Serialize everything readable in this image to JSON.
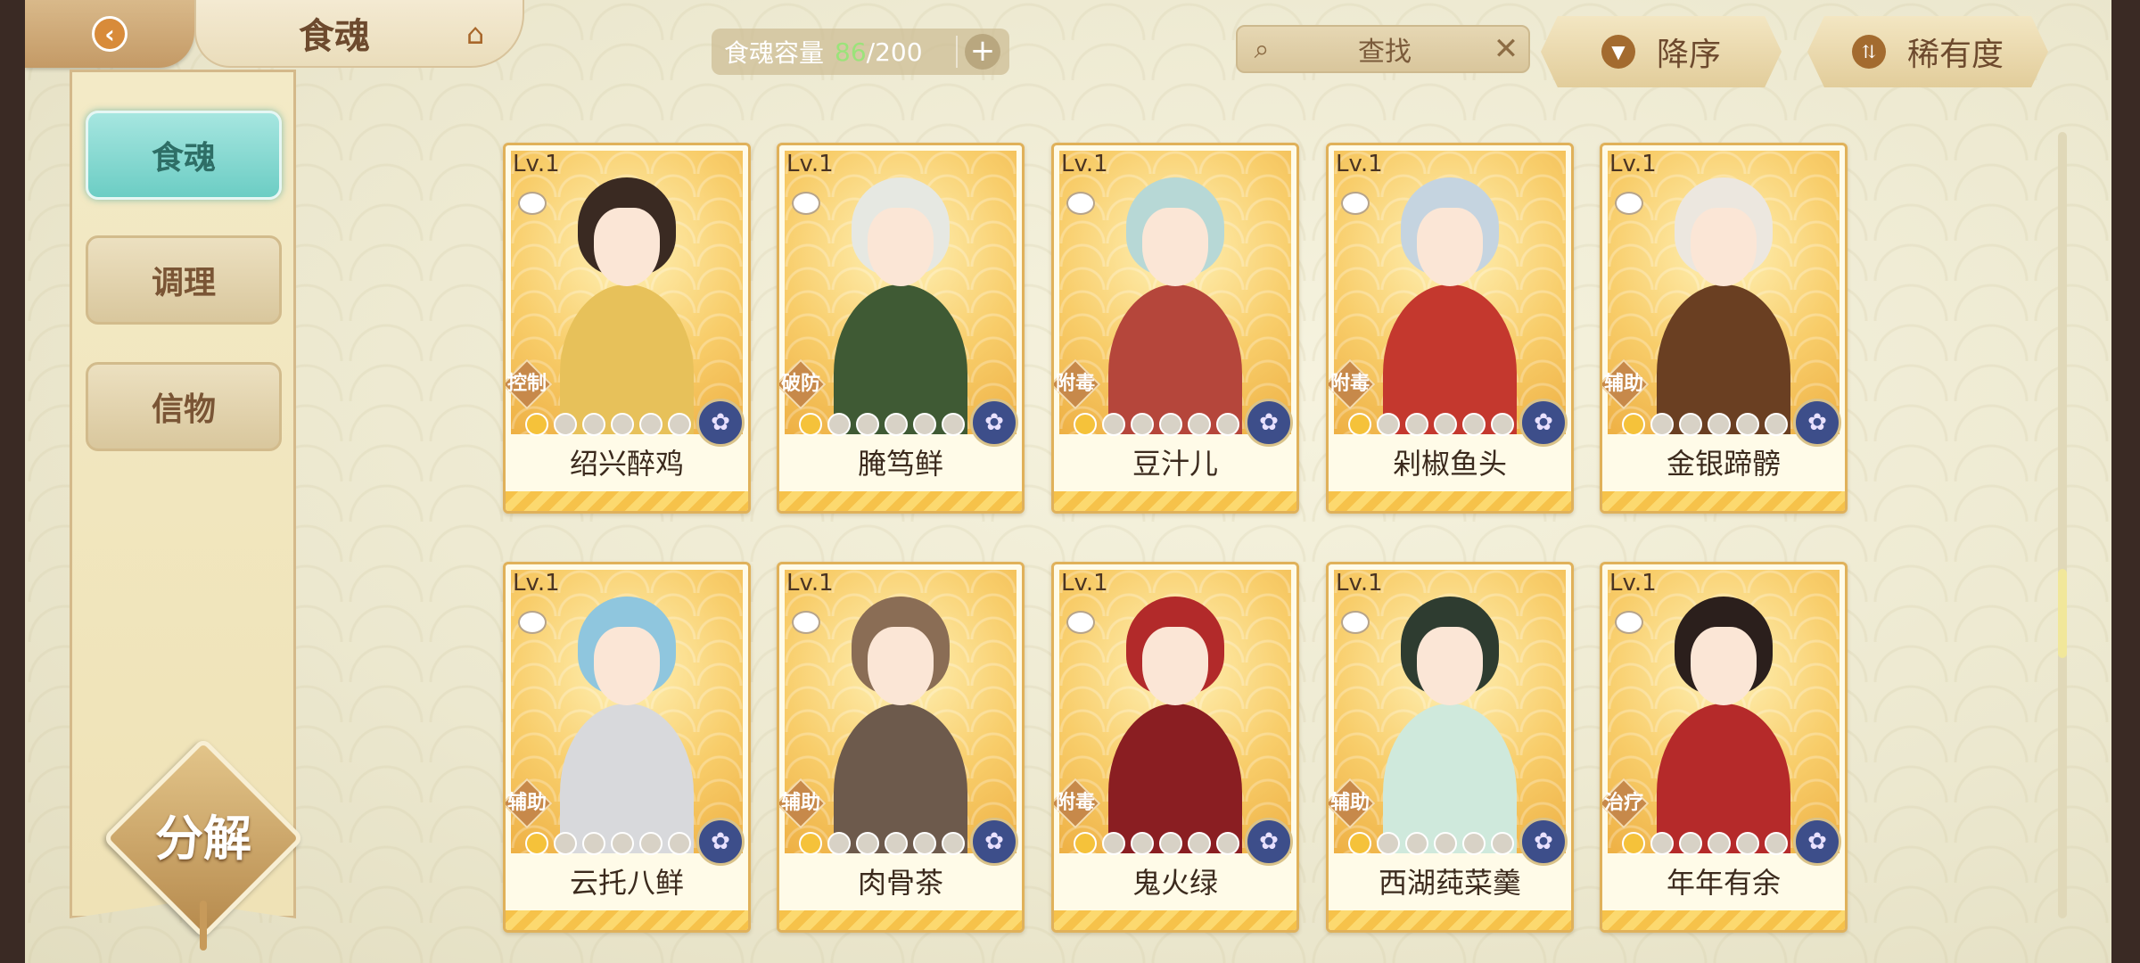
{
  "header": {
    "back_icon": "back-arrow-icon",
    "title": "食魂",
    "home_icon": "pavilion-icon",
    "capacity": {
      "label": "食魂容量",
      "current": "86",
      "max": "/200",
      "plus": "+"
    },
    "search": {
      "label": "查找",
      "icon": "search-icon",
      "clear_icon": "close-icon"
    },
    "sort_button": {
      "label": "降序",
      "icon": "triangle-down-icon"
    },
    "rarity_button": {
      "label": "稀有度",
      "icon": "sort-arrows-icon"
    }
  },
  "sidebar": {
    "items": [
      {
        "label": "食魂",
        "active": true
      },
      {
        "label": "调理",
        "active": false
      },
      {
        "label": "信物",
        "active": false
      }
    ],
    "decompose_label": "分解"
  },
  "cards": [
    {
      "level": "Lv.1",
      "name": "绍兴醉鸡",
      "role": "控制",
      "stars": 1,
      "colors": {
        "hair": "#3a2a22",
        "body": "#e7c15a"
      }
    },
    {
      "level": "Lv.1",
      "name": "腌笃鲜",
      "role": "破防",
      "stars": 1,
      "colors": {
        "hair": "#e6e8e2",
        "body": "#3f5a34"
      }
    },
    {
      "level": "Lv.1",
      "name": "豆汁儿",
      "role": "附毒",
      "stars": 1,
      "colors": {
        "hair": "#b7d8d6",
        "body": "#b5463b"
      }
    },
    {
      "level": "Lv.1",
      "name": "剁椒鱼头",
      "role": "附毒",
      "stars": 1,
      "colors": {
        "hair": "#c5d4e0",
        "body": "#c4382e"
      }
    },
    {
      "level": "Lv.1",
      "name": "金银蹄髈",
      "role": "辅助",
      "stars": 1,
      "colors": {
        "hair": "#ece7df",
        "body": "#6a3f22"
      }
    },
    {
      "level": "Lv.1",
      "name": "云托八鲜",
      "role": "辅助",
      "stars": 1,
      "colors": {
        "hair": "#8fc6de",
        "body": "#d8d9dc"
      }
    },
    {
      "level": "Lv.1",
      "name": "肉骨茶",
      "role": "辅助",
      "stars": 1,
      "colors": {
        "hair": "#8a6d55",
        "body": "#6d5a4c"
      }
    },
    {
      "level": "Lv.1",
      "name": "鬼火绿",
      "role": "附毒",
      "stars": 1,
      "colors": {
        "hair": "#b22a2a",
        "body": "#8a1e22"
      }
    },
    {
      "level": "Lv.1",
      "name": "西湖莼菜羹",
      "role": "辅助",
      "stars": 1,
      "colors": {
        "hair": "#2e3c30",
        "body": "#cfe9dc"
      }
    },
    {
      "level": "Lv.1",
      "name": "年年有余",
      "role": "治疗",
      "stars": 1,
      "colors": {
        "hair": "#2b1f1c",
        "body": "#b52a2a"
      }
    }
  ],
  "card_badge_icon": "flower-medallion-icon",
  "card_badge_glyph": "✿",
  "max_stars": 6
}
